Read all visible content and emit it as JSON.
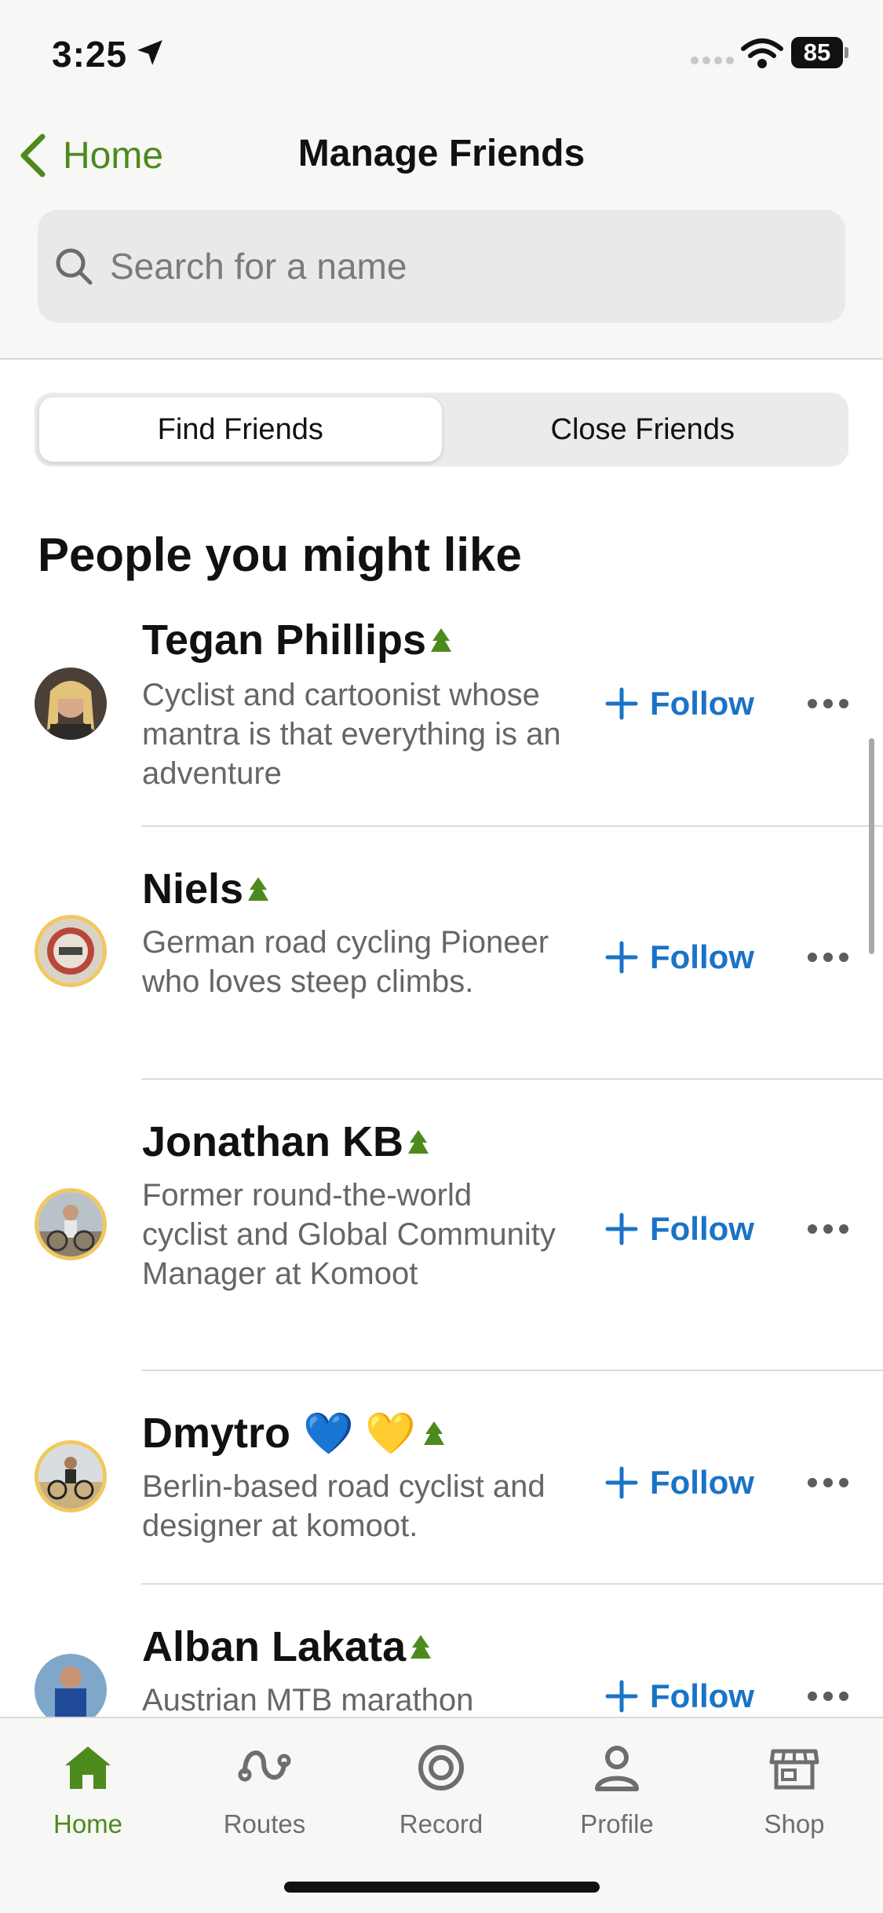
{
  "status_bar": {
    "time": "3:25",
    "battery": "85"
  },
  "nav": {
    "back_label": "Home",
    "title": "Manage Friends"
  },
  "search": {
    "placeholder": "Search for a name"
  },
  "tabs_segment": [
    {
      "label": "Find Friends",
      "active": true
    },
    {
      "label": "Close Friends",
      "active": false
    }
  ],
  "section": {
    "title": "People you might like"
  },
  "follow_label": "Follow",
  "people": [
    {
      "name": "Tegan Phillips",
      "emoji": "",
      "bio": "Cyclist and cartoonist whose mantra is that everything is an adventure"
    },
    {
      "name": "Niels",
      "emoji": "",
      "bio": "German road cycling Pioneer who loves steep climbs."
    },
    {
      "name": "Jonathan KB",
      "emoji": "",
      "bio": "Former round-the-world cyclist and Global Community Manager at Komoot"
    },
    {
      "name": "Dmytro",
      "emoji": "💙 💛",
      "bio": "Berlin-based road cyclist and designer at komoot."
    },
    {
      "name": "Alban Lakata",
      "emoji": "",
      "bio": "Austrian MTB marathon"
    }
  ],
  "tabbar": [
    {
      "label": "Home",
      "icon": "home-icon",
      "active": true
    },
    {
      "label": "Routes",
      "icon": "routes-icon",
      "active": false
    },
    {
      "label": "Record",
      "icon": "record-icon",
      "active": false
    },
    {
      "label": "Profile",
      "icon": "profile-icon",
      "active": false
    },
    {
      "label": "Shop",
      "icon": "shop-icon",
      "active": false
    }
  ],
  "colors": {
    "accent": "#4d8a1e",
    "follow": "#1a73c7",
    "ring": "#f1c85f"
  }
}
